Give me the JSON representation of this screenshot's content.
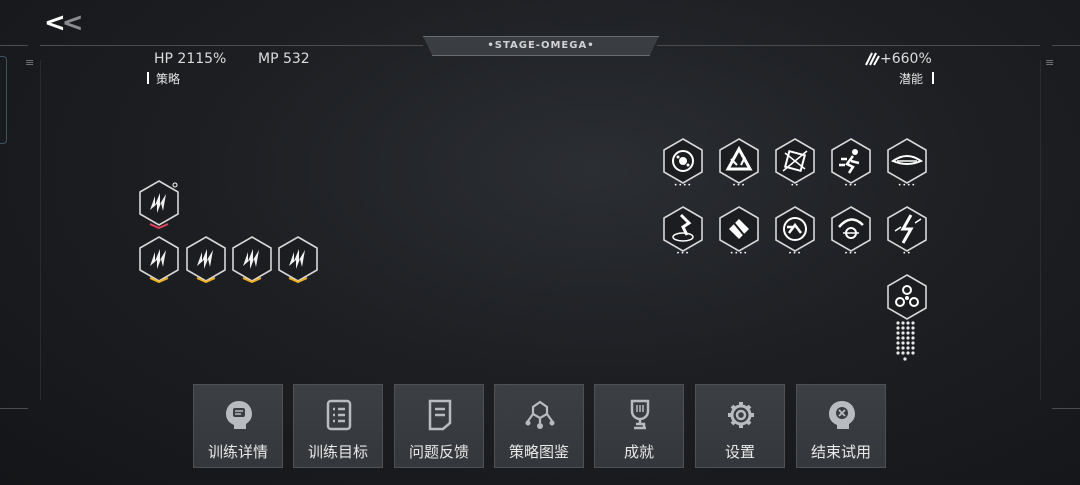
{
  "nav": {
    "back_symbol": "<<"
  },
  "stage": {
    "title": "•STAGE-OMEGA•"
  },
  "stats": {
    "hp": "HP 2115%",
    "mp": "MP 532",
    "bonus": "+660%"
  },
  "panels": {
    "left_label": "策略",
    "right_label": "潜能"
  },
  "strategy_icons": {
    "top": {
      "icon": "lightning-claw-icon",
      "dots": ""
    },
    "row": [
      {
        "icon": "lightning-claw-icon"
      },
      {
        "icon": "lightning-claw-icon"
      },
      {
        "icon": "lightning-claw-icon"
      },
      {
        "icon": "lightning-claw-icon"
      }
    ]
  },
  "potential_icons": {
    "row1": [
      {
        "icon": "orb-icon",
        "dots": "••••"
      },
      {
        "icon": "triangle-arrow-icon",
        "dots": "•••"
      },
      {
        "icon": "shatter-icon",
        "dots": "••"
      },
      {
        "icon": "dash-runner-icon",
        "dots": "•••"
      },
      {
        "icon": "speed-wave-icon",
        "dots": "••••"
      }
    ],
    "row2": [
      {
        "icon": "ground-strike-icon",
        "dots": "•••"
      },
      {
        "icon": "diamond-slash-icon",
        "dots": "••••"
      },
      {
        "icon": "spin-sprint-icon",
        "dots": "•••"
      },
      {
        "icon": "crescent-eye-icon",
        "dots": "•••"
      },
      {
        "icon": "spark-burst-icon",
        "dots": "••"
      }
    ],
    "special": {
      "icon": "triple-core-icon"
    }
  },
  "buttons": [
    {
      "label": "训练详情",
      "icon": "head-chat-icon"
    },
    {
      "label": "训练目标",
      "icon": "checklist-icon"
    },
    {
      "label": "问题反馈",
      "icon": "feedback-document-icon"
    },
    {
      "label": "策略图鉴",
      "icon": "strategy-node-icon"
    },
    {
      "label": "成就",
      "icon": "trophy-icon"
    },
    {
      "label": "设置",
      "icon": "gear-icon"
    },
    {
      "label": "结束试用",
      "icon": "head-exit-icon"
    }
  ],
  "colors": {
    "accent_red": "#e0405a",
    "accent_gold": "#f0b020",
    "button_bg": "#3a3d42"
  }
}
